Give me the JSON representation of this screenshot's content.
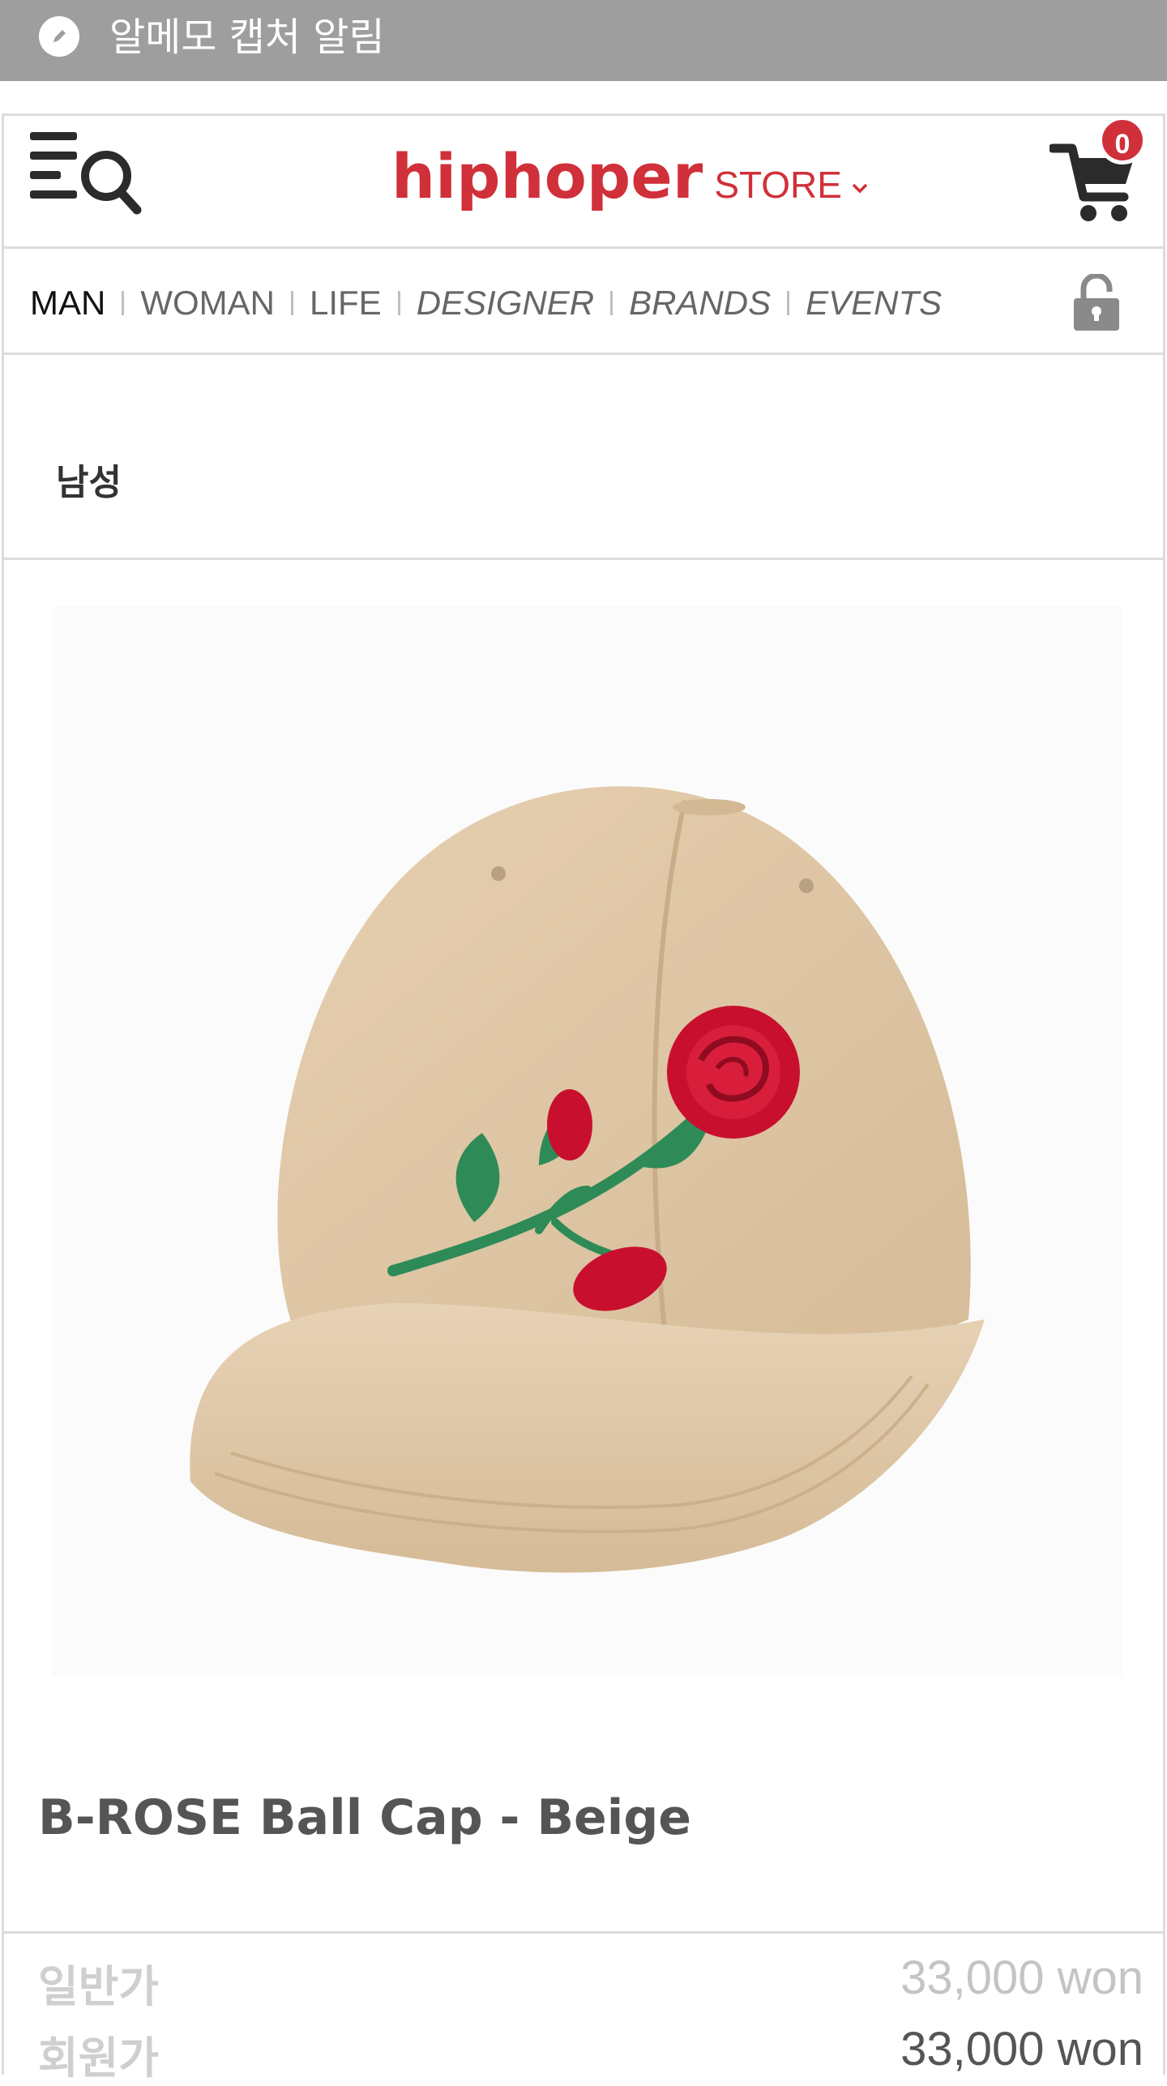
{
  "notification": {
    "title": "알메모 캡처 알림",
    "icon": "pen-icon"
  },
  "header": {
    "brand": "hiphoper",
    "store_label": "STORE",
    "cart_count": "0",
    "brand_color": "#d0303a"
  },
  "nav": {
    "items": [
      {
        "label": "MAN"
      },
      {
        "label": "WOMAN"
      },
      {
        "label": "LIFE"
      },
      {
        "label": "DESIGNER"
      },
      {
        "label": "BRANDS"
      },
      {
        "label": "EVENTS"
      }
    ],
    "active": "MAN"
  },
  "section": {
    "title": "남성"
  },
  "product": {
    "name": "B-ROSE Ball Cap - Beige",
    "image_alt": "Beige ball cap with embroidered red rose",
    "prices": {
      "regular_label": "일반가",
      "regular_value": "33,000 won",
      "member_label": "회원가",
      "member_value": "33,000 won"
    }
  }
}
